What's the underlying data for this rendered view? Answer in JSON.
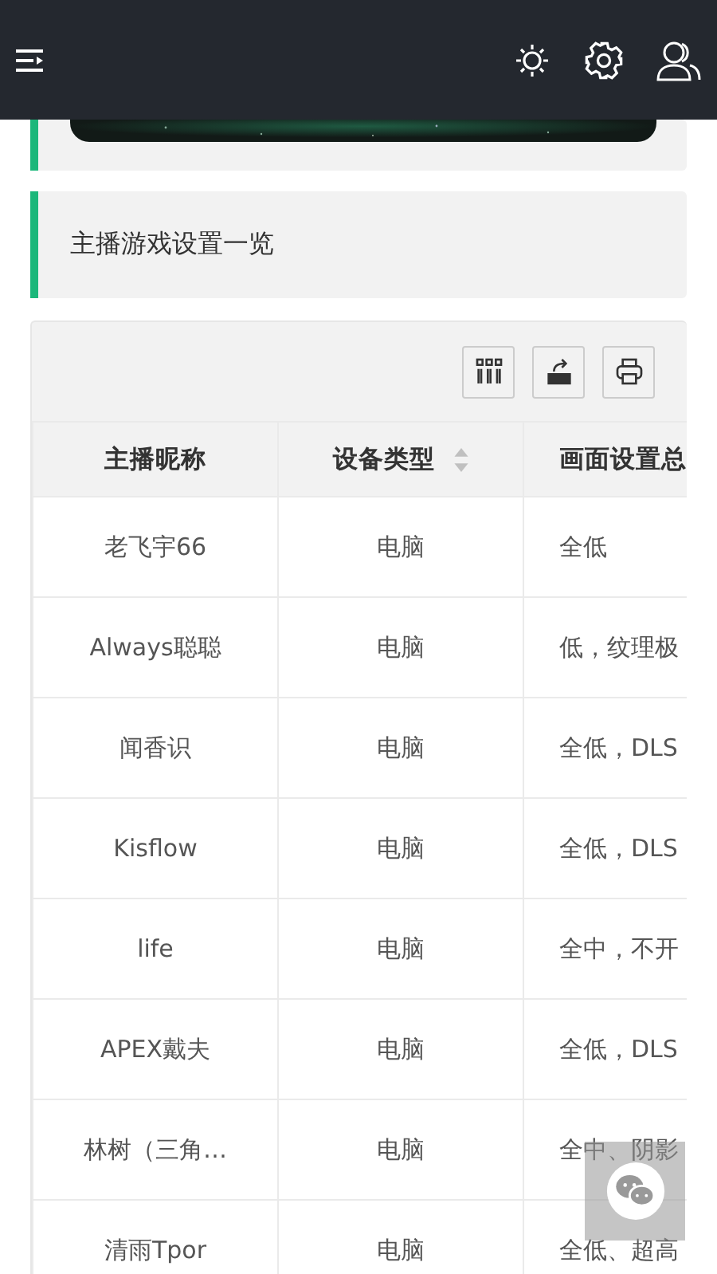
{
  "section": {
    "title": "主播游戏设置一览"
  },
  "table": {
    "toolbar": [
      {
        "kind": "columns"
      },
      {
        "kind": "export"
      },
      {
        "kind": "print"
      }
    ],
    "columns": [
      {
        "label": "主播昵称"
      },
      {
        "label": "设备类型",
        "sortable": true
      },
      {
        "label": "画面设置总"
      }
    ],
    "rows": [
      [
        "老飞宇66",
        "电脑",
        "全低"
      ],
      [
        "Always聪聪",
        "电脑",
        "低，纹理极"
      ],
      [
        "闻香识",
        "电脑",
        "全低，DLS"
      ],
      [
        "Kisflow",
        "电脑",
        "全低，DLS"
      ],
      [
        "life",
        "电脑",
        "全中，不开"
      ],
      [
        "APEX戴夫",
        "电脑",
        "全低，DLS"
      ],
      [
        "林树（三角…",
        "电脑",
        "全中、阴影"
      ],
      [
        "清雨Tpor",
        "电脑",
        "全低、超高"
      ]
    ]
  },
  "float_button": {
    "kind": "chat"
  }
}
